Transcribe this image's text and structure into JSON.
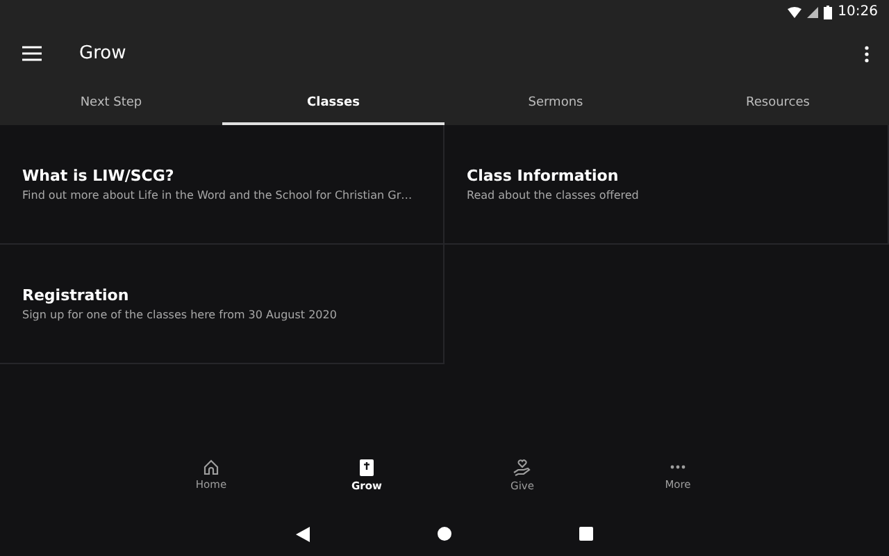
{
  "status_bar": {
    "time": "10:26"
  },
  "app_bar": {
    "title": "Grow"
  },
  "tabs": [
    {
      "label": "Next Step",
      "selected": false
    },
    {
      "label": "Classes",
      "selected": true
    },
    {
      "label": "Sermons",
      "selected": false
    },
    {
      "label": "Resources",
      "selected": false
    }
  ],
  "cards": [
    {
      "title": "What is LIW/SCG?",
      "subtitle": "Find out more about Life in the Word and the School for Christian Gr…"
    },
    {
      "title": "Class Information",
      "subtitle": "Read about the classes offered"
    },
    {
      "title": "Registration",
      "subtitle": "Sign up for one of the classes here from 30 August 2020"
    }
  ],
  "bottom_nav": [
    {
      "label": "Home",
      "selected": false
    },
    {
      "label": "Grow",
      "selected": true
    },
    {
      "label": "Give",
      "selected": false
    },
    {
      "label": "More",
      "selected": false
    }
  ]
}
